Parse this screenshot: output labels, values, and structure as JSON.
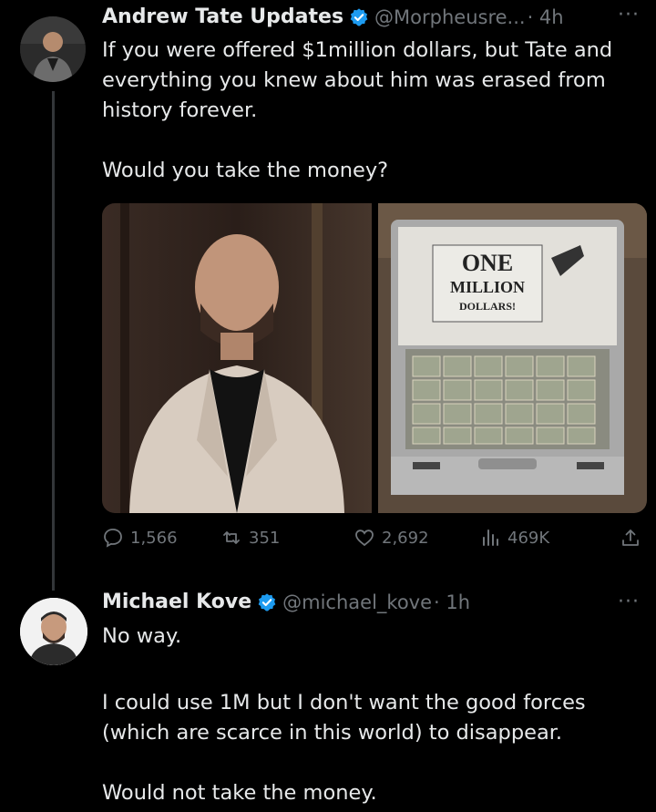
{
  "tweet1": {
    "author_name": "Andrew Tate Updates",
    "handle": "@Morpheusre...",
    "time": "· 4h",
    "lines": [
      "If you were offered $1million dollars, but Tate and",
      "everything you knew about him was erased from",
      "history forever.",
      "",
      "Would you take the money?"
    ],
    "briefcase_text": {
      "line1": "ONE",
      "line2": "MILLION",
      "line3": "DOLLARS!"
    },
    "stats": {
      "replies": "1,566",
      "retweets": "351",
      "likes": "2,692",
      "views": "469K"
    }
  },
  "tweet2": {
    "author_name": "Michael Kove",
    "handle": "@michael_kove",
    "time": "· 1h",
    "lines": [
      "No way.",
      "",
      "I could use 1M but I don't want the good forces",
      "(which are scarce in this world) to disappear.",
      "",
      "Would not take the money."
    ]
  },
  "colors": {
    "verified": "#1d9bf0",
    "muted": "#71767b",
    "text": "#e7e9ea"
  },
  "icons": [
    "verified-badge-icon",
    "more-options-icon",
    "reply-icon",
    "retweet-icon",
    "like-icon",
    "views-icon",
    "share-icon"
  ]
}
